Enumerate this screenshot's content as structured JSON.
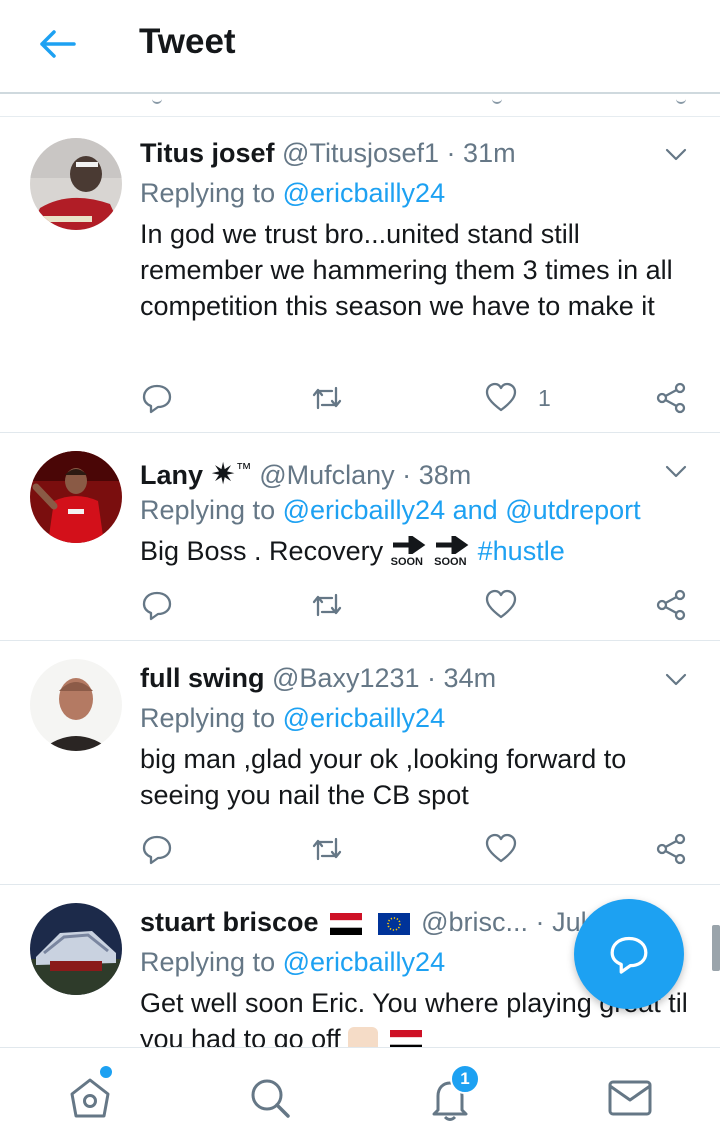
{
  "header": {
    "title": "Tweet"
  },
  "tweets": [
    {
      "name": "Titus josef",
      "handle": "@Titusjosef1",
      "dot": "·",
      "time": "31m",
      "replying_label": "Replying to",
      "mentions": [
        "@ericbailly24"
      ],
      "text": "In god we trust bro...united stand still remember we hammering them 3 times in all competition this season we have to make it",
      "likes": "1"
    },
    {
      "name": "Lany",
      "name_symbol": "✷",
      "name_badge": "™",
      "handle": "@Mufclany",
      "dot": "·",
      "time": "38m",
      "replying_label": "Replying to",
      "mentions": [
        "@ericbailly24",
        "and",
        "@utdreport"
      ],
      "text": "Big Boss . Recovery",
      "soon_label": "SOON",
      "hashtag": "#hustle"
    },
    {
      "name": "full swing",
      "handle": "@Baxy1231",
      "dot": "·",
      "time": "34m",
      "replying_label": "Replying to",
      "mentions": [
        "@ericbailly24"
      ],
      "text": "big man ,glad your ok ,looking forward to seeing you nail the CB spot"
    },
    {
      "name": "stuart briscoe",
      "handle": "@brisc...",
      "dot": "·",
      "time": "Jul",
      "replying_label": "Replying to",
      "mentions": [
        "@ericbailly24"
      ],
      "text": "Get well soon Eric. You where playing great til you had to go off"
    }
  ],
  "nav": {
    "notifications_count": "1"
  },
  "colors": {
    "accent": "#1da1f2",
    "text": "#14171a",
    "muted": "#657786"
  },
  "icons": [
    "back-arrow-icon",
    "chevron-down-icon",
    "reply-icon",
    "retweet-icon",
    "like-icon",
    "share-icon",
    "compose-reply-icon",
    "home-icon",
    "search-icon",
    "notifications-icon",
    "messages-icon"
  ]
}
